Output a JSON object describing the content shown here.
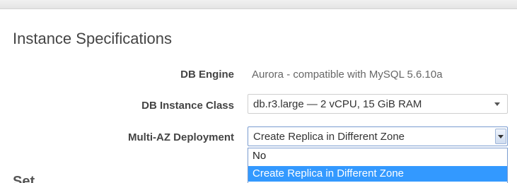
{
  "section": {
    "title": "Instance Specifications"
  },
  "fields": {
    "db_engine": {
      "label": "DB Engine",
      "value": "Aurora - compatible with MySQL 5.6.10a"
    },
    "db_instance_class": {
      "label": "DB Instance Class",
      "value": "db.r3.large — 2 vCPU, 15 GiB RAM"
    },
    "multi_az": {
      "label": "Multi-AZ Deployment",
      "value": "Create Replica in Different Zone",
      "options": [
        "No",
        "Create Replica in Different Zone"
      ],
      "highlighted": "Create Replica in Different Zone"
    }
  },
  "next_section_fragment": "Set..."
}
